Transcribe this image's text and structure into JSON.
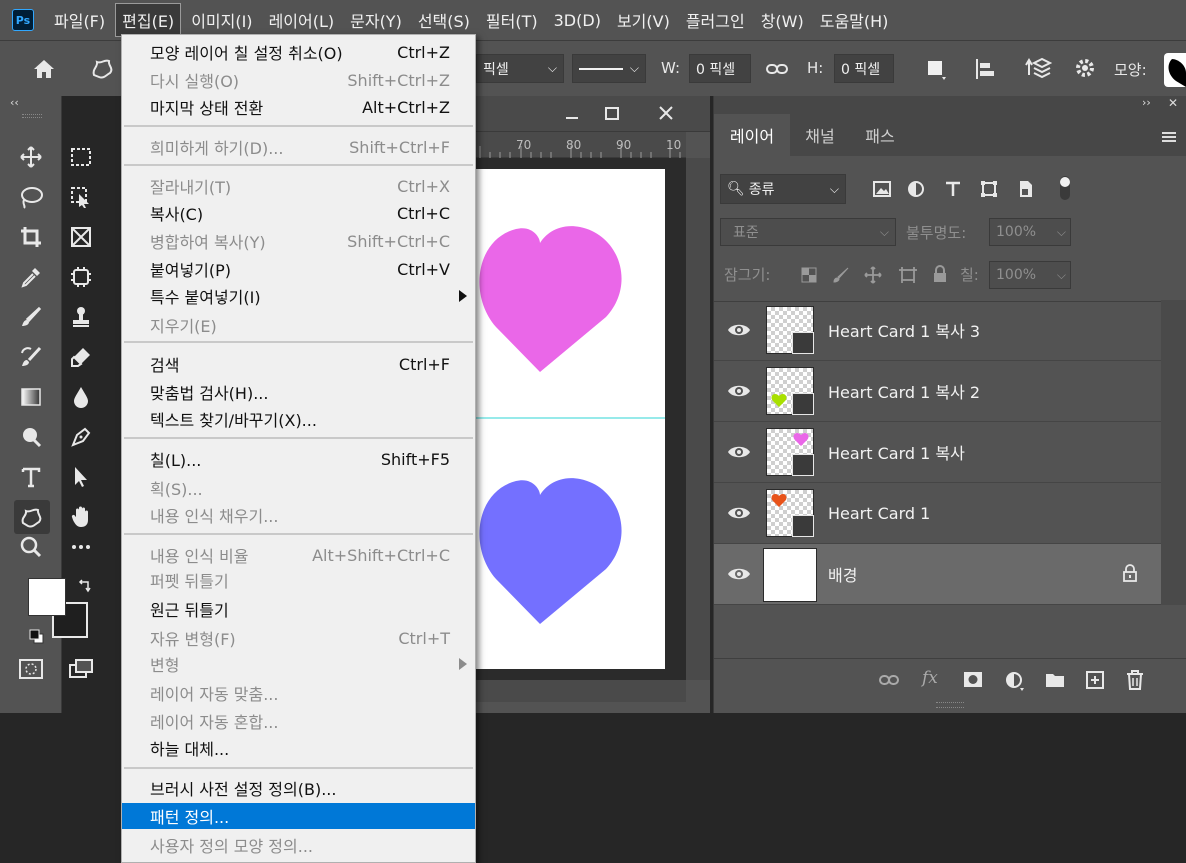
{
  "menubar": {
    "logo": "Ps",
    "items": [
      "파일(F)",
      "편집(E)",
      "이미지(I)",
      "레이어(L)",
      "문자(Y)",
      "선택(S)",
      "필터(T)",
      "3D(D)",
      "보기(V)",
      "플러그인",
      "창(W)",
      "도움말(H)"
    ]
  },
  "options": {
    "unit_value": "픽셀",
    "w_label": "W:",
    "w_value": "0 픽셀",
    "h_label": "H:",
    "h_value": "0 픽셀",
    "shape_label": "모양:"
  },
  "ruler": {
    "ticks": [
      "70",
      "80",
      "90",
      "10"
    ]
  },
  "canvas": {
    "top_heart_color": "#ea67e8",
    "bottom_heart_color": "#7470ff",
    "guide_color": "#2fd6d6"
  },
  "toolbar": {
    "collapse": "‹‹"
  },
  "layers_panel": {
    "tabs": [
      "레이어",
      "채널",
      "패스"
    ],
    "filter_kind": "종류",
    "blend_mode": "표준",
    "opacity_label": "불투명도:",
    "opacity_value": "100%",
    "lock_label": "잠그기:",
    "fill_label": "칠:",
    "fill_value": "100%",
    "layers": [
      {
        "name": "Heart Card 1 복사 3",
        "heart": ""
      },
      {
        "name": "Heart Card 1 복사 2",
        "heart": "#a8e000"
      },
      {
        "name": "Heart Card 1 복사",
        "heart": "#ea67e8"
      },
      {
        "name": "Heart Card 1",
        "heart": "#e8531a"
      },
      {
        "name": "배경",
        "heart": ""
      }
    ]
  },
  "edit_menu": {
    "items": [
      {
        "label": "모양 레이어 칠 설정 취소(O)",
        "shortcut": "Ctrl+Z",
        "disabled": false
      },
      {
        "label": "다시 실행(O)",
        "shortcut": "Shift+Ctrl+Z",
        "disabled": true
      },
      {
        "label": "마지막 상태 전환",
        "shortcut": "Alt+Ctrl+Z",
        "disabled": false
      },
      {
        "label": "희미하게 하기(D)...",
        "shortcut": "Shift+Ctrl+F",
        "disabled": true
      },
      {
        "label": "잘라내기(T)",
        "shortcut": "Ctrl+X",
        "disabled": true
      },
      {
        "label": "복사(C)",
        "shortcut": "Ctrl+C",
        "disabled": false
      },
      {
        "label": "병합하여 복사(Y)",
        "shortcut": "Shift+Ctrl+C",
        "disabled": true
      },
      {
        "label": "붙여넣기(P)",
        "shortcut": "Ctrl+V",
        "disabled": false
      },
      {
        "label": "특수 붙여넣기(I)",
        "shortcut": "",
        "disabled": false
      },
      {
        "label": "지우기(E)",
        "shortcut": "",
        "disabled": true
      },
      {
        "label": "검색",
        "shortcut": "Ctrl+F",
        "disabled": false
      },
      {
        "label": "맞춤법 검사(H)...",
        "shortcut": "",
        "disabled": false
      },
      {
        "label": "텍스트 찾기/바꾸기(X)...",
        "shortcut": "",
        "disabled": false
      },
      {
        "label": "칠(L)...",
        "shortcut": "Shift+F5",
        "disabled": false
      },
      {
        "label": "획(S)...",
        "shortcut": "",
        "disabled": true
      },
      {
        "label": "내용 인식 채우기...",
        "shortcut": "",
        "disabled": true
      },
      {
        "label": "내용 인식 비율",
        "shortcut": "Alt+Shift+Ctrl+C",
        "disabled": true
      },
      {
        "label": "퍼펫 뒤틀기",
        "shortcut": "",
        "disabled": true
      },
      {
        "label": "원근 뒤틀기",
        "shortcut": "",
        "disabled": false
      },
      {
        "label": "자유 변형(F)",
        "shortcut": "Ctrl+T",
        "disabled": true
      },
      {
        "label": "변형",
        "shortcut": "",
        "disabled": true
      },
      {
        "label": "레이어 자동 맞춤...",
        "shortcut": "",
        "disabled": true
      },
      {
        "label": "레이어 자동 혼합...",
        "shortcut": "",
        "disabled": true
      },
      {
        "label": "하늘 대체...",
        "shortcut": "",
        "disabled": false
      },
      {
        "label": "브러시 사전 설정 정의(B)...",
        "shortcut": "",
        "disabled": false
      },
      {
        "label": "패턴 정의...",
        "shortcut": "",
        "disabled": false
      },
      {
        "label": "사용자 정의 모양 정의...",
        "shortcut": "",
        "disabled": true
      }
    ]
  }
}
